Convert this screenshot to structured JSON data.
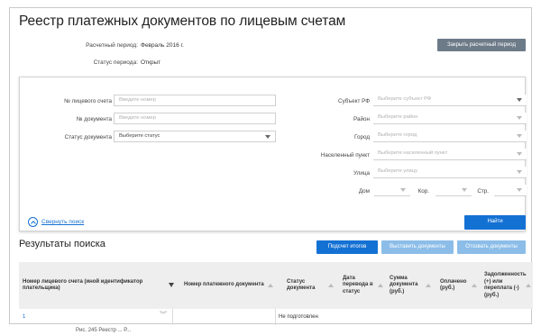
{
  "page": {
    "title": "Реестр платежных документов по лицевым счетам"
  },
  "period": {
    "label": "Расчетный период:",
    "value": "Февраль 2016 г.",
    "status_label": "Статус периода:",
    "status_value": "Открыт",
    "close_button": "Закрыть расчетный период"
  },
  "filters": {
    "account_label": "№ лицевого счета",
    "account_placeholder": "Введите номер",
    "document_label": "№ документа",
    "document_placeholder": "Введите номер",
    "status_label": "Статус документа",
    "status_value": "Выберите статус",
    "subject_label": "Субъект РФ",
    "subject_placeholder": "Выберите субъект РФ",
    "district_label": "Район",
    "district_placeholder": "Выберите район",
    "city_label": "Город",
    "city_placeholder": "Выберите город",
    "settlement_label": "Населенный пункт",
    "settlement_placeholder": "Выберите населенный пункт",
    "street_label": "Улица",
    "street_placeholder": "Выберите улицу",
    "house_label": "Дом",
    "building_label": "Кор.",
    "structure_label": "Стр.",
    "collapse_link": "Свернуть поиск",
    "find_button": "Найти"
  },
  "results": {
    "title": "Результаты поиска",
    "calc_button": "Подсчет итогов",
    "issue_button": "Выставить документы",
    "revoke_button": "Отозвать документы",
    "columns": [
      "Номер лицевого счета (иной идентификатор плательщика)",
      "Номер платежного документа",
      "Статус документа",
      "Дата перевода в статус",
      "Сумма документа (руб.)",
      "Оплачено (руб.)",
      "Задолженность (+) или переплата (-) (руб.)"
    ],
    "rows": [
      {
        "account": "1",
        "document": "",
        "status": "Не подготовлен",
        "date": "",
        "sum": "",
        "paid": "",
        "debt": ""
      }
    ]
  },
  "caption": "Рис. 245 Реестр ... Р..."
}
